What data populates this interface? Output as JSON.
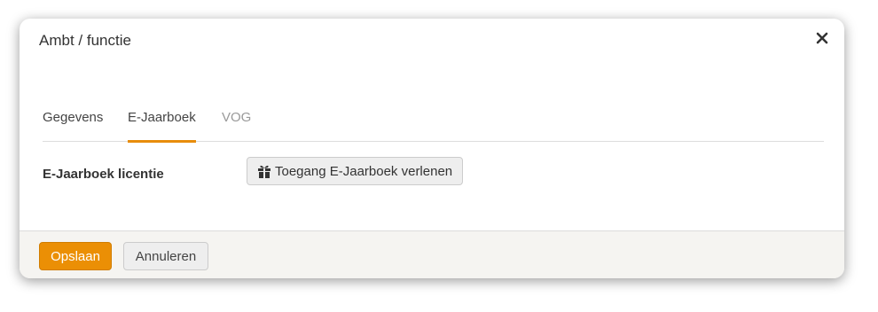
{
  "modal": {
    "title": "Ambt / functie",
    "close_icon": "close-icon"
  },
  "tabs": [
    {
      "label": "Gegevens",
      "active": false
    },
    {
      "label": "E-Jaarboek",
      "active": true
    },
    {
      "label": "VOG",
      "active": false
    }
  ],
  "form": {
    "license_label": "E-Jaarboek licentie",
    "grant_button_icon": "gift-icon",
    "grant_button_label": "Toegang E-Jaarboek verlenen"
  },
  "footer": {
    "save_label": "Opslaan",
    "cancel_label": "Annuleren"
  },
  "colors": {
    "accent": "#eb8f05",
    "tab_underline": "#e88d0c",
    "footer_bg": "#f5f4f1"
  }
}
